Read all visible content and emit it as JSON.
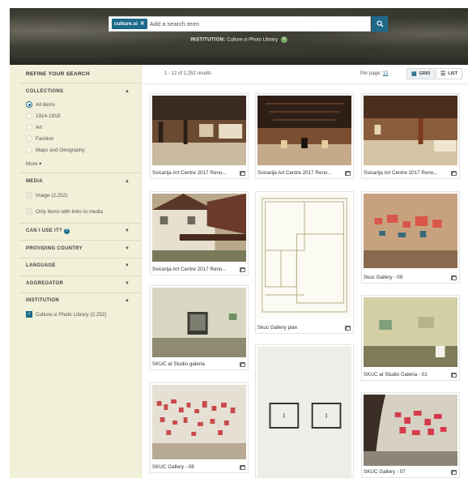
{
  "search": {
    "chip_label": "culture.si",
    "chip_close": "✕",
    "placeholder": "Add a search term",
    "institution_label": "INSTITUTION:",
    "institution_value": "Culture.si Photo Library"
  },
  "sidebar": {
    "title": "REFINE YOUR SEARCH",
    "collections": {
      "heading": "COLLECTIONS",
      "items": [
        "All items",
        "1914-1918",
        "Art",
        "Fashion",
        "Maps and Geography"
      ],
      "selected": "All items",
      "more": "More ▾"
    },
    "media": {
      "heading": "MEDIA",
      "image_option": "Image (2,252)",
      "links_option": "Only items with links to media"
    },
    "can_i_use": "CAN I USE IT?",
    "providing_country": "PROVIDING COUNTRY",
    "language": "LANGUAGE",
    "aggregator": "AGGREGATOR",
    "institution": {
      "heading": "INSTITUTION",
      "option": "Culture.si Photo Library (2,252)"
    }
  },
  "results": {
    "count_text": "1 - 12 of 2,252 results",
    "per_page_label": "Per page:",
    "per_page_value": "12",
    "grid_label": "GRID",
    "list_label": "LIST"
  },
  "cards": [
    {
      "title": "Švicarija Art Centre 2017 Reno..."
    },
    {
      "title": "Švicarija Art Centre 2017 Reno..."
    },
    {
      "title": "Švicarija Art Centre 2017 Reno..."
    },
    {
      "title": "Švicarija Art Centre 2017 Reno..."
    },
    {
      "title": "Škuc Gallery plan"
    },
    {
      "title": "Škuc Gallery - 09"
    },
    {
      "title": "ŠKUC at Studio galeria"
    },
    {
      "title": "ŠKUC at Studio Galeria - 01"
    },
    {
      "title": "ŠKUC Gallery - 08"
    },
    {
      "title": ""
    },
    {
      "title": "ŠKUC Gallery - 07"
    }
  ],
  "colors": {
    "accent": "#1d6a8a",
    "sidebar_bg": "#f0f1d8"
  }
}
